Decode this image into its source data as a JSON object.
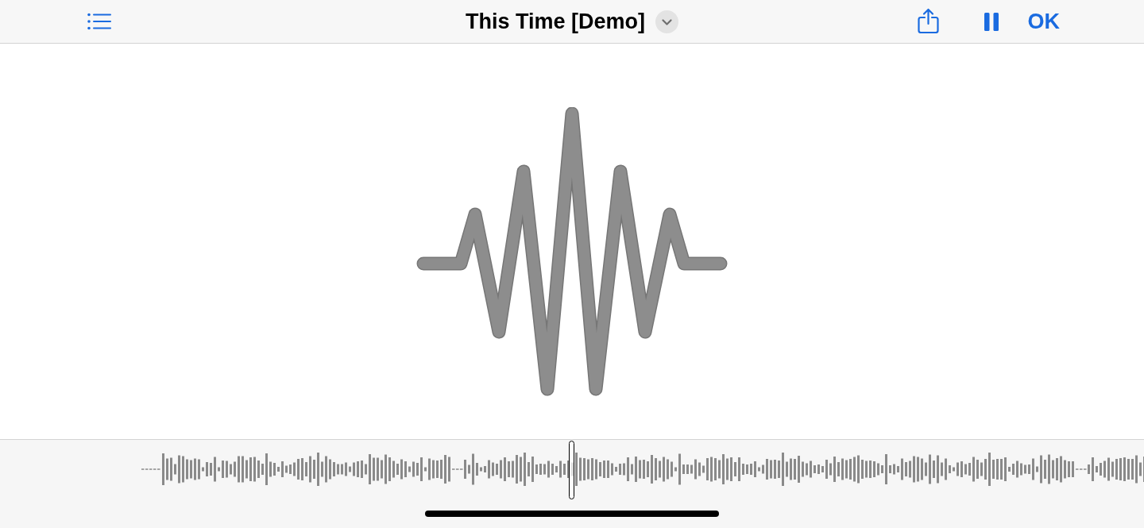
{
  "toolbar": {
    "title": "This Time [Demo]",
    "playing": true,
    "confirm_button": "OK"
  }
}
